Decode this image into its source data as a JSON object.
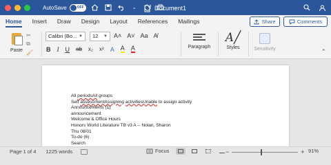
{
  "titlebar": {
    "autosave_label": "AutoSave",
    "autosave_state": "OFF",
    "document_title": "Document1"
  },
  "tabs": [
    {
      "label": "Home"
    },
    {
      "label": "Insert"
    },
    {
      "label": "Draw"
    },
    {
      "label": "Design"
    },
    {
      "label": "Layout"
    },
    {
      "label": "References"
    },
    {
      "label": "Mailings"
    }
  ],
  "share_label": "Share",
  "comments_label": "Comments",
  "ribbon": {
    "paste_label": "Paste",
    "font_name": "Calibri (Bo...",
    "font_size": "12",
    "paragraph_label": "Paragraph",
    "styles_label": "Styles",
    "sensitivity_label": "Sensitivity",
    "format_row1": [
      "A˄",
      "A˅",
      "Aa",
      "A̸"
    ],
    "format_row2": [
      "B",
      "I",
      "U",
      "ab",
      "x₂",
      "x²",
      "A",
      "A",
      "A"
    ]
  },
  "document": {
    "lines": [
      {
        "parts": [
          {
            "t": "All "
          },
          {
            "t": "periodsAll",
            "squig": true
          },
          {
            "t": " groups"
          }
        ]
      },
      {
        "parts": [
          {
            "t": "Self "
          },
          {
            "t": "assessmentAssigning",
            "squig": true
          },
          {
            "t": " "
          },
          {
            "t": "activitiesUnable",
            "squig": true
          },
          {
            "t": " to assign activity"
          }
        ]
      },
      {
        "parts": [
          {
            "t": "Announcements (1)"
          }
        ]
      },
      {
        "parts": [
          {
            "t": "announcement"
          }
        ]
      },
      {
        "parts": [
          {
            "t": "Welcome & Office Hours"
          }
        ]
      },
      {
        "parts": [
          {
            "t": "Honors World Literature TB v3 A -- Nolan, Sharon"
          }
        ]
      },
      {
        "parts": [
          {
            "t": "Thu 08/01"
          }
        ]
      },
      {
        "parts": [
          {
            "t": "To-do (6)"
          }
        ]
      },
      {
        "parts": [
          {
            "t": "Search"
          }
        ]
      }
    ]
  },
  "statusbar": {
    "page_info": "Page 1 of 4",
    "word_count": "1225 words",
    "focus_label": "Focus",
    "zoom_percent": "91%",
    "zoom_fraction": 0.44
  }
}
